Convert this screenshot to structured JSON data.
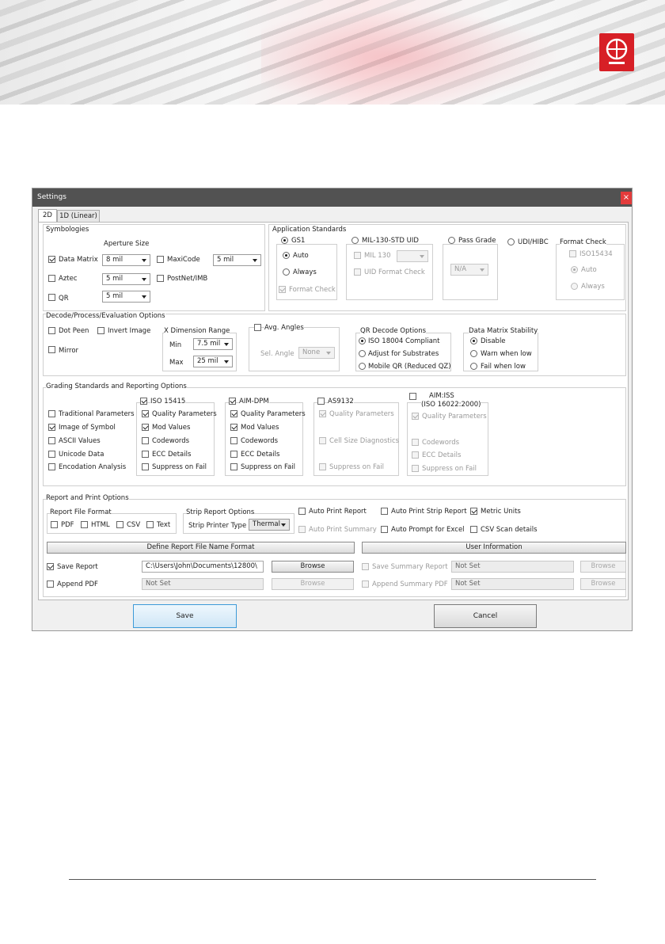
{
  "window": {
    "title": "Settings",
    "close_glyph": "×"
  },
  "tabs": [
    {
      "label": "2D",
      "active": true
    },
    {
      "label": "1D (Linear)",
      "active": false
    }
  ],
  "symbologies": {
    "title": "Symbologies",
    "aperture_header": "Aperture Size",
    "data_matrix": {
      "label": "Data Matrix",
      "checked": true,
      "aperture": "8 mil"
    },
    "aztec": {
      "label": "Aztec",
      "checked": false,
      "aperture": "5 mil"
    },
    "qr": {
      "label": "QR",
      "checked": false,
      "aperture": "5 mil"
    },
    "maxicode": {
      "label": "MaxiCode",
      "checked": false,
      "aperture": "5 mil"
    },
    "postnet": {
      "label": "PostNet/IMB",
      "checked": false
    }
  },
  "application_standards": {
    "title": "Application Standards",
    "gs1": {
      "label": "GS1",
      "auto": "Auto",
      "always": "Always",
      "format_check": "Format Check"
    },
    "mil": {
      "label": "MIL-130-STD UID",
      "mil130": "MIL 130",
      "uid_format_check": "UID Format Check"
    },
    "pass_grade": {
      "label": "Pass Grade",
      "value": "N/A"
    },
    "udi": {
      "label": "UDI/HIBC"
    },
    "format_check": {
      "title": "Format Check",
      "iso": "ISO15434",
      "auto": "Auto",
      "always": "Always"
    }
  },
  "decode": {
    "title": "Decode/Process/Evaluation Options",
    "dot_peen": "Dot Peen",
    "invert_image": "Invert Image",
    "mirror": "Mirror",
    "xdim": {
      "title": "X Dimension Range",
      "min_label": "Min",
      "min": "7.5 mil",
      "max_label": "Max",
      "max": "25 mil"
    },
    "avg_angles": {
      "label": "Avg. Angles",
      "sel_angle": "Sel. Angle",
      "value": "None"
    },
    "qr_options": {
      "title": "QR Decode Options",
      "opt1": "ISO 18004 Compliant",
      "opt2": "Adjust for Substrates",
      "opt3": "Mobile QR (Reduced QZ)"
    },
    "dm_stability": {
      "title": "Data Matrix Stability",
      "opt1": "Disable",
      "opt2": "Warn when low",
      "opt3": "Fail when low"
    }
  },
  "grading": {
    "title": "Grading Standards and Reporting Options",
    "left": [
      "Traditional Parameters",
      "Image of Symbol",
      "ASCII Values",
      "Unicode Data",
      "Encodation Analysis"
    ],
    "iso15415": {
      "title": "ISO 15415",
      "items": [
        "Quality Parameters",
        "Mod Values",
        "Codewords",
        "ECC Details",
        "Suppress on Fail"
      ]
    },
    "aimdpm": {
      "title": "AIM-DPM",
      "items": [
        "Quality Parameters",
        "Mod Values",
        "Codewords",
        "ECC Details",
        "Suppress on Fail"
      ]
    },
    "as9132": {
      "title": "AS9132",
      "items": [
        "Quality Parameters",
        "Cell Size Diagnostics",
        "Suppress on Fail"
      ]
    },
    "aimiss": {
      "title1": "AIM:ISS",
      "title2": "(ISO 16022:2000)",
      "items": [
        "Quality Parameters",
        "Codewords",
        "ECC Details",
        "Suppress on Fail"
      ]
    }
  },
  "report": {
    "title": "Report and Print Options",
    "file_format": {
      "title": "Report File Format",
      "pdf": "PDF",
      "html": "HTML",
      "csv": "CSV",
      "text": "Text"
    },
    "strip": {
      "title": "Strip Report Options",
      "type_label": "Strip Printer Type",
      "type_value": "Thermal"
    },
    "auto_print_report": "Auto Print Report",
    "auto_print_strip": "Auto Print Strip Report",
    "metric_units": "Metric Units",
    "auto_print_summary": "Auto Print Summary",
    "auto_prompt_excel": "Auto Prompt for Excel",
    "csv_scan": "CSV Scan details",
    "define_btn": "Define Report File Name Format",
    "user_info_btn": "User Information",
    "save_report": "Save Report",
    "save_path": "C:\\Users\\John\\Documents\\12800\\",
    "browse": "Browse",
    "append_pdf": "Append PDF",
    "not_set": "Not Set",
    "save_summary": "Save Summary Report",
    "append_summary": "Append Summary PDF"
  },
  "footer": {
    "save": "Save",
    "cancel": "Cancel"
  }
}
